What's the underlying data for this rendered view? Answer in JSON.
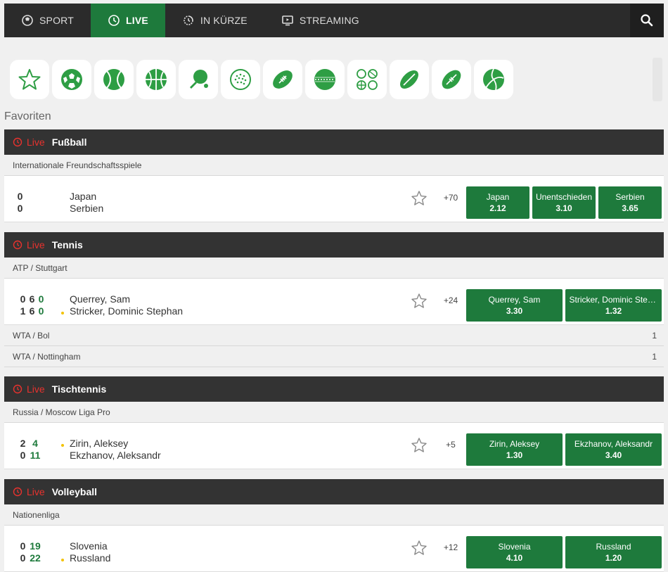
{
  "nav": {
    "items": [
      {
        "label": "SPORT",
        "icon": "soccer-globe-icon"
      },
      {
        "label": "LIVE",
        "icon": "clock-icon"
      },
      {
        "label": "IN KÜRZE",
        "icon": "timer-icon"
      },
      {
        "label": "STREAMING",
        "icon": "tv-icon"
      }
    ]
  },
  "sport_icons": [
    "star-icon",
    "football-icon",
    "tennis-icon",
    "basketball-icon",
    "table-tennis-icon",
    "golf-icon",
    "american-football-icon",
    "cricket-icon",
    "multi-sport-icon",
    "rugby-icon",
    "aussie-rules-icon",
    "volleyball-icon"
  ],
  "favorites_title": "Favoriten",
  "live_label": "Live",
  "colors": {
    "accent": "#1e7a3c",
    "live_red": "#e8322e",
    "header_dark": "#333333"
  },
  "sections": [
    {
      "sport": "Fußball",
      "league": "Internationale Freundschaftsspiele",
      "match": {
        "scores": [
          [
            "0"
          ],
          [
            "0"
          ]
        ],
        "teams": [
          "Japan",
          "Serbien"
        ],
        "more": "+70",
        "odds": [
          {
            "label": "Japan",
            "value": "2.12"
          },
          {
            "label": "Unentschieden",
            "value": "3.10"
          },
          {
            "label": "Serbien",
            "value": "3.65"
          }
        ]
      }
    },
    {
      "sport": "Tennis",
      "league": "ATP / Stuttgart",
      "match": {
        "scores": [
          [
            "0",
            "6",
            "0"
          ],
          [
            "1",
            "6",
            "0"
          ]
        ],
        "teams": [
          "Querrey, Sam",
          "Stricker, Dominic Stephan"
        ],
        "more": "+24",
        "odds": [
          {
            "label": "Querrey, Sam",
            "value": "3.30"
          },
          {
            "label": "Stricker, Dominic Stephan",
            "value": "1.32"
          }
        ]
      },
      "extra_leagues": [
        {
          "name": "WTA / Bol",
          "count": "1"
        },
        {
          "name": "WTA / Nottingham",
          "count": "1"
        }
      ]
    },
    {
      "sport": "Tischtennis",
      "league": "Russia / Moscow Liga Pro",
      "match": {
        "scores": [
          [
            "2",
            "4"
          ],
          [
            "0",
            "11"
          ]
        ],
        "teams": [
          "Zirin, Aleksey",
          "Ekzhanov, Aleksandr"
        ],
        "more": "+5",
        "odds": [
          {
            "label": "Zirin, Aleksey",
            "value": "1.30"
          },
          {
            "label": "Ekzhanov, Aleksandr",
            "value": "3.40"
          }
        ]
      }
    },
    {
      "sport": "Volleyball",
      "league": "Nationenliga",
      "match": {
        "scores": [
          [
            "0",
            "19"
          ],
          [
            "0",
            "22"
          ]
        ],
        "teams": [
          "Slovenia",
          "Russland"
        ],
        "more": "+12",
        "odds": [
          {
            "label": "Slovenia",
            "value": "4.10"
          },
          {
            "label": "Russland",
            "value": "1.20"
          }
        ]
      }
    }
  ]
}
